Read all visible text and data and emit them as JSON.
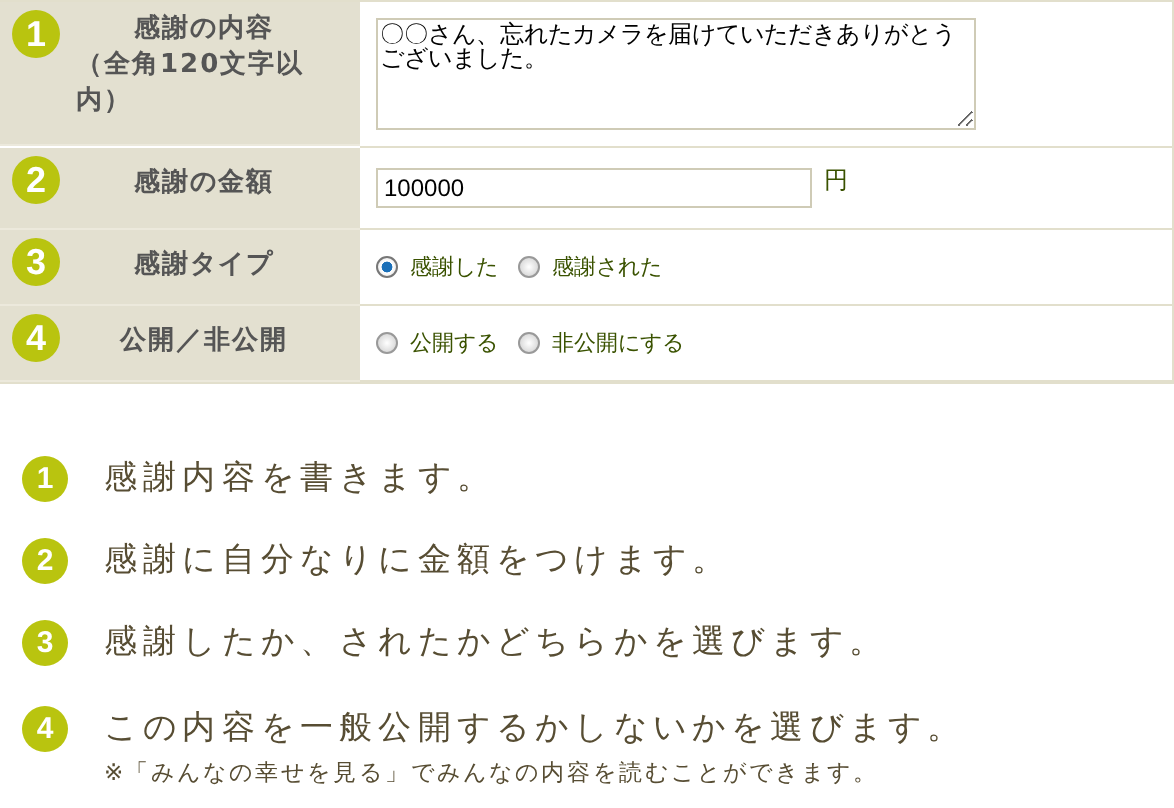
{
  "form": {
    "rows": [
      {
        "number": "1",
        "label": "感謝の内容",
        "sublabel": "（全角120文字以内）",
        "kind": "textarea",
        "value": "〇〇さん、忘れたカメラを届けていただきありがとうございました。"
      },
      {
        "number": "2",
        "label": "感謝の金額",
        "kind": "text",
        "value": "100000",
        "unit": "円"
      },
      {
        "number": "3",
        "label": "感謝タイプ",
        "kind": "radio",
        "options": [
          {
            "label": "感謝した",
            "selected": true
          },
          {
            "label": "感謝された",
            "selected": false
          }
        ]
      },
      {
        "number": "4",
        "label": "公開／非公開",
        "kind": "radio",
        "options": [
          {
            "label": "公開する",
            "selected": false
          },
          {
            "label": "非公開にする",
            "selected": false
          }
        ]
      }
    ]
  },
  "steps": [
    {
      "number": "1",
      "text": "感謝内容を書きます。"
    },
    {
      "number": "2",
      "text": "感謝に自分なりに金額をつけます。"
    },
    {
      "number": "3",
      "text": "感謝したか、されたかどちらかを選びます。"
    },
    {
      "number": "4",
      "text": "この内容を一般公開するかしないかを選びます。",
      "note": "※「みんなの幸せを見る」でみんなの内容を読むことができます。"
    }
  ]
}
